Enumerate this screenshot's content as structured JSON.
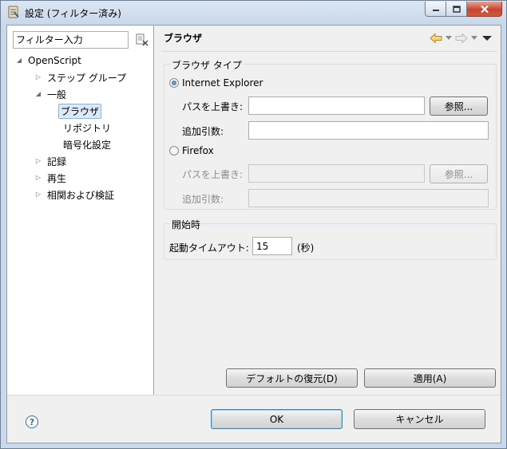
{
  "window": {
    "title": "設定 (フィルター済み)"
  },
  "left": {
    "filter_placeholder": "フィルター入力",
    "tree": [
      {
        "label": "OpenScript",
        "expander": "◢",
        "selected": false
      },
      {
        "label": "ステップ グループ",
        "expander": "▷",
        "selected": false
      },
      {
        "label": "一般",
        "expander": "◢",
        "selected": false
      },
      {
        "label": "ブラウザ",
        "expander": "",
        "selected": true
      },
      {
        "label": "リポジトリ",
        "expander": "",
        "selected": false
      },
      {
        "label": "暗号化設定",
        "expander": "",
        "selected": false
      },
      {
        "label": "記録",
        "expander": "▷",
        "selected": false
      },
      {
        "label": "再生",
        "expander": "▷",
        "selected": false
      },
      {
        "label": "相関および検証",
        "expander": "▷",
        "selected": false
      }
    ]
  },
  "right": {
    "page_title": "ブラウザ",
    "browser_type_group": {
      "label": "ブラウザ タイプ",
      "ie": {
        "label": "Internet Explorer",
        "checked": true,
        "path_label": "パスを上書き:",
        "path_value": "",
        "args_label": "追加引数:",
        "args_value": "",
        "browse_label": "参照..."
      },
      "firefox": {
        "label": "Firefox",
        "checked": false,
        "path_label": "パスを上書き:",
        "path_value": "",
        "args_label": "追加引数:",
        "args_value": "",
        "browse_label": "参照..."
      }
    },
    "startup_group": {
      "label": "開始時",
      "timeout_label": "起動タイムアウト:",
      "timeout_value": "15",
      "unit": "(秒)"
    },
    "restore_defaults_label": "デフォルトの復元(D)",
    "apply_label": "適用(A)"
  },
  "footer": {
    "ok_label": "OK",
    "cancel_label": "キャンセル",
    "help_glyph": "?"
  },
  "colors": {
    "selection_bg": "#dce9f7",
    "selection_border": "#8eb3e0",
    "close_button": "#c7452f",
    "default_button_border": "#3c7fb1"
  }
}
